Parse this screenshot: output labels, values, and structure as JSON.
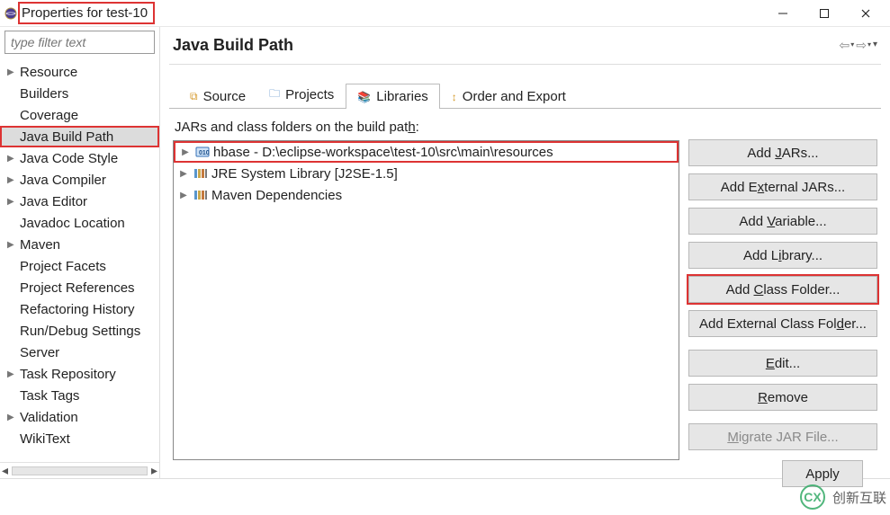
{
  "window": {
    "title": "Properties for test-10"
  },
  "sidebar": {
    "filter_placeholder": "type filter text",
    "items": [
      {
        "label": "Resource",
        "expandable": true
      },
      {
        "label": "Builders",
        "expandable": false
      },
      {
        "label": "Coverage",
        "expandable": false
      },
      {
        "label": "Java Build Path",
        "expandable": false,
        "selected": true
      },
      {
        "label": "Java Code Style",
        "expandable": true
      },
      {
        "label": "Java Compiler",
        "expandable": true
      },
      {
        "label": "Java Editor",
        "expandable": true
      },
      {
        "label": "Javadoc Location",
        "expandable": false
      },
      {
        "label": "Maven",
        "expandable": true
      },
      {
        "label": "Project Facets",
        "expandable": false
      },
      {
        "label": "Project References",
        "expandable": false
      },
      {
        "label": "Refactoring History",
        "expandable": false
      },
      {
        "label": "Run/Debug Settings",
        "expandable": false
      },
      {
        "label": "Server",
        "expandable": false
      },
      {
        "label": "Task Repository",
        "expandable": true
      },
      {
        "label": "Task Tags",
        "expandable": false
      },
      {
        "label": "Validation",
        "expandable": true
      },
      {
        "label": "WikiText",
        "expandable": false
      }
    ]
  },
  "content": {
    "header_title": "Java Build Path",
    "tabs": [
      {
        "label": "Source"
      },
      {
        "label": "Projects"
      },
      {
        "label": "Libraries",
        "active": true
      },
      {
        "label": "Order and Export"
      }
    ],
    "libraries": {
      "instructions_prefix": "JARs and class folders on the build pat",
      "instructions_hotkey": "h",
      "instructions_suffix": ":",
      "entries": [
        {
          "label": "hbase - D:\\eclipse-workspace\\test-10\\src\\main\\resources",
          "icon": "box",
          "highlight": true
        },
        {
          "label": "JRE System Library [J2SE-1.5]",
          "icon": "lib"
        },
        {
          "label": "Maven Dependencies",
          "icon": "lib"
        }
      ]
    },
    "buttons": {
      "add_jars": "Add JARs...",
      "add_external_jars_pre": "Add E",
      "add_external_jars_hk": "x",
      "add_external_jars_post": "ternal JARs...",
      "add_variable_pre": "Add ",
      "add_variable_hk": "V",
      "add_variable_post": "ariable...",
      "add_library_pre": "Add L",
      "add_library_hk": "i",
      "add_library_post": "brary...",
      "add_class_folder_pre": "Add ",
      "add_class_folder_hk": "C",
      "add_class_folder_post": "lass Folder...",
      "add_ext_class_folder_pre": "Add External Class Fol",
      "add_ext_class_folder_hk": "d",
      "add_ext_class_folder_post": "er...",
      "edit_hk": "E",
      "edit_post": "dit...",
      "remove_hk": "R",
      "remove_post": "emove",
      "migrate_hk": "M",
      "migrate_post": "igrate JAR File..."
    }
  },
  "footer": {
    "apply": "Apply"
  },
  "watermark": {
    "brand": "创新互联",
    "logo": "CX"
  }
}
